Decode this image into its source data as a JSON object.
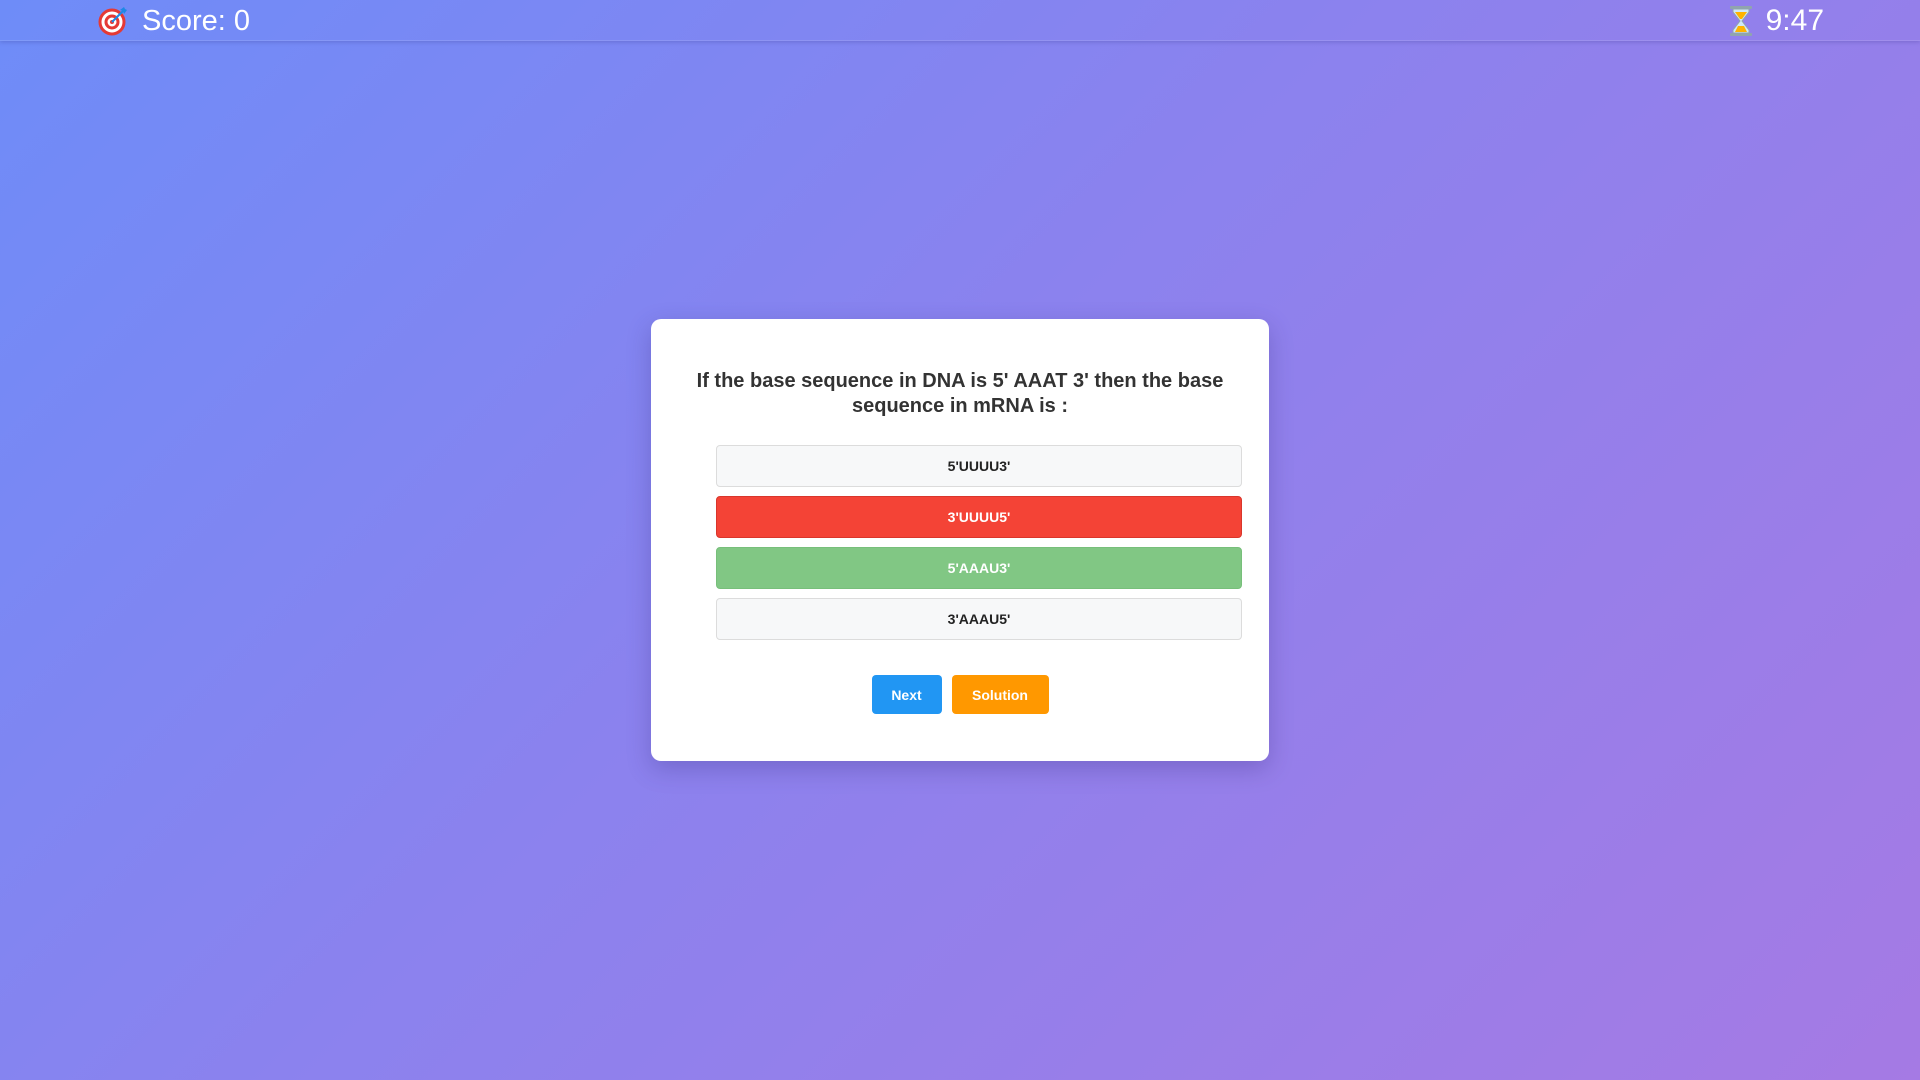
{
  "header": {
    "score_text": "Score: 0",
    "score_icon": "target-icon",
    "timer_text": "9:47",
    "timer_icon": "hourglass-icon"
  },
  "quiz": {
    "question": "If the base sequence in DNA is 5' AAAT 3' then the base sequence in mRNA is :",
    "options": [
      {
        "label": "5'UUUU3'",
        "state": "neutral"
      },
      {
        "label": "3'UUUU5'",
        "state": "wrong"
      },
      {
        "label": "5'AAAU3'",
        "state": "correct"
      },
      {
        "label": "3'AAAU5'",
        "state": "neutral"
      }
    ],
    "next_label": "Next",
    "solution_label": "Solution"
  },
  "colors": {
    "background_start": "#6e8cf8",
    "background_end": "#a57ae4",
    "wrong": "#f44336",
    "correct": "#81c784",
    "next": "#2196f3",
    "solution": "#ff9800"
  }
}
